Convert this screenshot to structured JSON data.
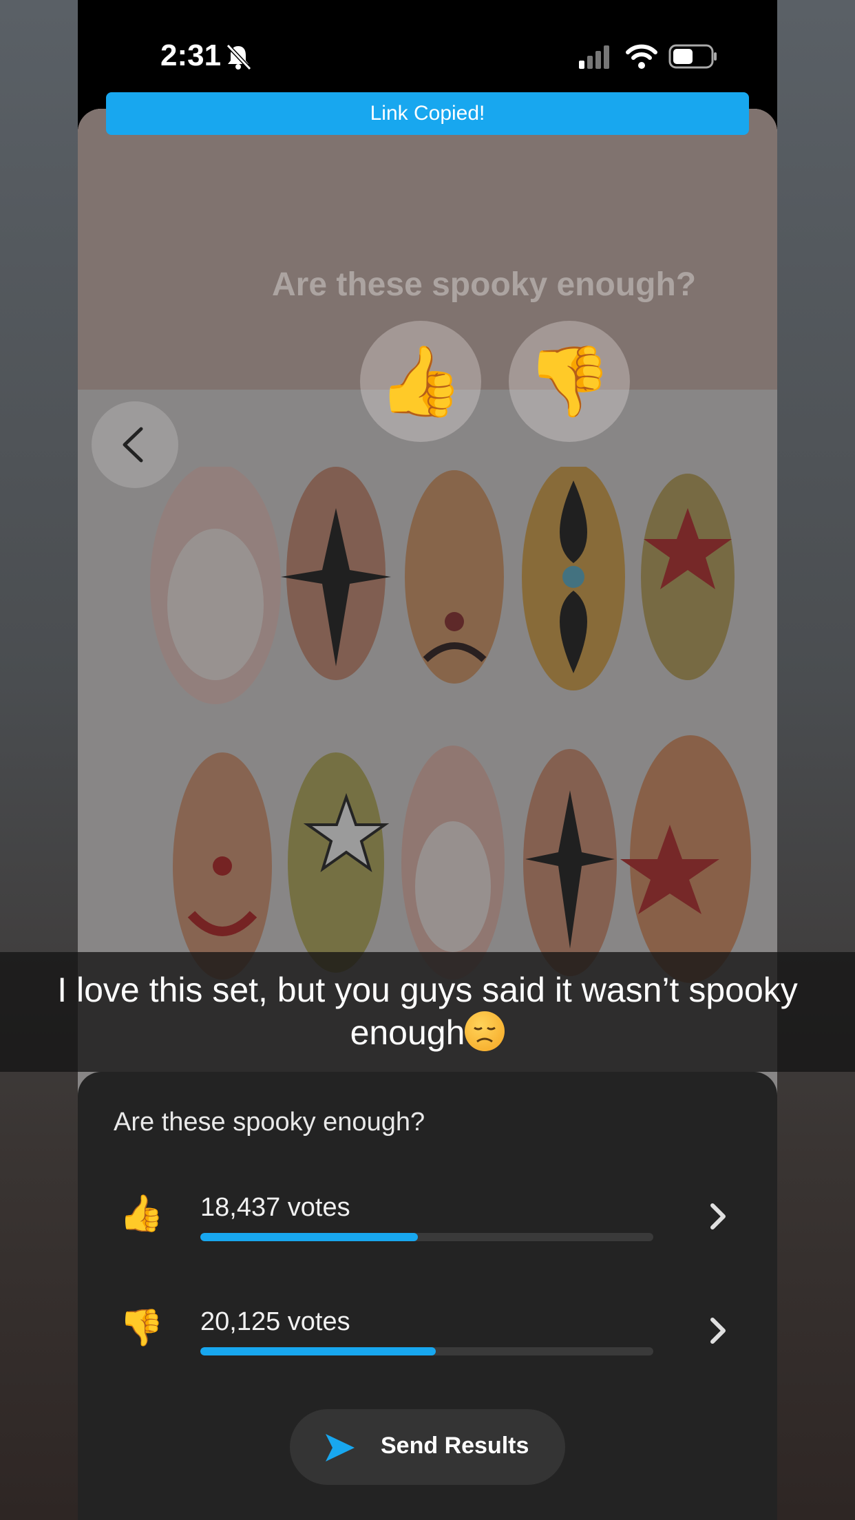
{
  "status_bar": {
    "time": "2:31",
    "icons": [
      "bell-slash-icon",
      "signal-icon",
      "wifi-icon",
      "battery-icon"
    ]
  },
  "toast": {
    "text": "Link Copied!"
  },
  "background_card": {
    "question": "Are these spooky enough?",
    "buttons": [
      "thumbs-up-icon",
      "thumbs-down-icon"
    ],
    "back_icon": "chevron-left-icon"
  },
  "caption": {
    "line1": "I love this set, but you guys said it wasn’t spooky",
    "line2": "enough",
    "emoji": "disappointed-face-icon"
  },
  "results_sheet": {
    "title": "Are these spooky enough?",
    "options": [
      {
        "icon": "thumbs-up-icon",
        "emoji": "👍",
        "votes_text": "18,437 votes",
        "fraction": 0.48
      },
      {
        "icon": "thumbs-down-icon",
        "emoji": "👎",
        "votes_text": "20,125 votes",
        "fraction": 0.52
      }
    ],
    "send_button": {
      "label": "Send Results",
      "icon": "send-arrow-icon"
    }
  },
  "colors": {
    "accent": "#18a7ef",
    "sheet_bg": "#232323",
    "track": "#3a3a3a"
  }
}
